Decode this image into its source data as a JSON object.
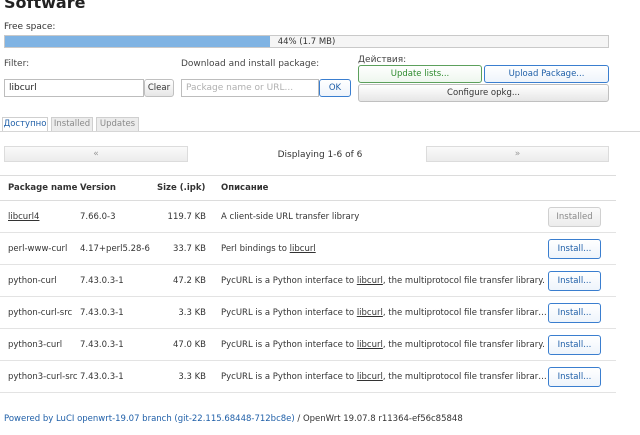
{
  "page": {
    "title": "Software"
  },
  "free_space": {
    "label": "Free space:",
    "percent": 44,
    "text": "44% (1.7 MB)"
  },
  "filter": {
    "label": "Filter:",
    "value": "libcurl",
    "clear_label": "Clear"
  },
  "download": {
    "label": "Download and install package:",
    "placeholder": "Package name or URL...",
    "ok_label": "OK"
  },
  "actions": {
    "label": "Действия:",
    "update_label": "Update lists...",
    "upload_label": "Upload Package...",
    "configure_label": "Configure opkg..."
  },
  "tabs": [
    {
      "label": "Доступно",
      "active": true
    },
    {
      "label": "Installed",
      "active": false
    },
    {
      "label": "Updates",
      "active": false
    }
  ],
  "pager": {
    "prev": "«",
    "info": "Displaying 1-6 of 6",
    "next": "»"
  },
  "table": {
    "headers": {
      "name": "Package name",
      "version": "Version",
      "size": "Size (.ipk)",
      "desc": "Описание"
    },
    "rows": [
      {
        "name": "libcurl4",
        "version": "7.66.0-3",
        "size": "119.7 KB",
        "desc_pre": "A client-side URL transfer library",
        "desc_link": "",
        "desc_post": "",
        "action": "Installed",
        "installed": true
      },
      {
        "name": "perl-www-curl",
        "version": "4.17+perl5.28-6",
        "size": "33.7 KB",
        "desc_pre": "Perl bindings to ",
        "desc_link": "libcurl",
        "desc_post": "",
        "action": "Install...",
        "installed": false
      },
      {
        "name": "python-curl",
        "version": "7.43.0.3-1",
        "size": "47.2 KB",
        "desc_pre": "PycURL is a Python interface to ",
        "desc_link": "libcurl",
        "desc_post": ", the multiprotocol file transfer library.",
        "action": "Install...",
        "installed": false
      },
      {
        "name": "python-curl-src",
        "version": "7.43.0.3-1",
        "size": "3.3 KB",
        "desc_pre": "PycURL is a Python interface to ",
        "desc_link": "libcurl",
        "desc_post": ", the multiprotocol file transfer library.....",
        "action": "Install...",
        "installed": false
      },
      {
        "name": "python3-curl",
        "version": "7.43.0.3-1",
        "size": "47.0 KB",
        "desc_pre": "PycURL is a Python interface to ",
        "desc_link": "libcurl",
        "desc_post": ", the multiprotocol file transfer library.",
        "action": "Install...",
        "installed": false
      },
      {
        "name": "python3-curl-src",
        "version": "7.43.0.3-1",
        "size": "3.3 KB",
        "desc_pre": "PycURL is a Python interface to ",
        "desc_link": "libcurl",
        "desc_post": ", the multiprotocol file transfer library.....",
        "action": "Install...",
        "installed": false
      }
    ]
  },
  "footer": {
    "link": "Powered by LuCI openwrt-19.07 branch (git-22.115.68448-712bc8e)",
    "text": " / OpenWrt 19.07.8 r11364-ef56c85848"
  },
  "colors": {
    "accent": "#1f5fa8",
    "progress_fill": "#7fb3e3",
    "green": "#2e8b2e"
  }
}
